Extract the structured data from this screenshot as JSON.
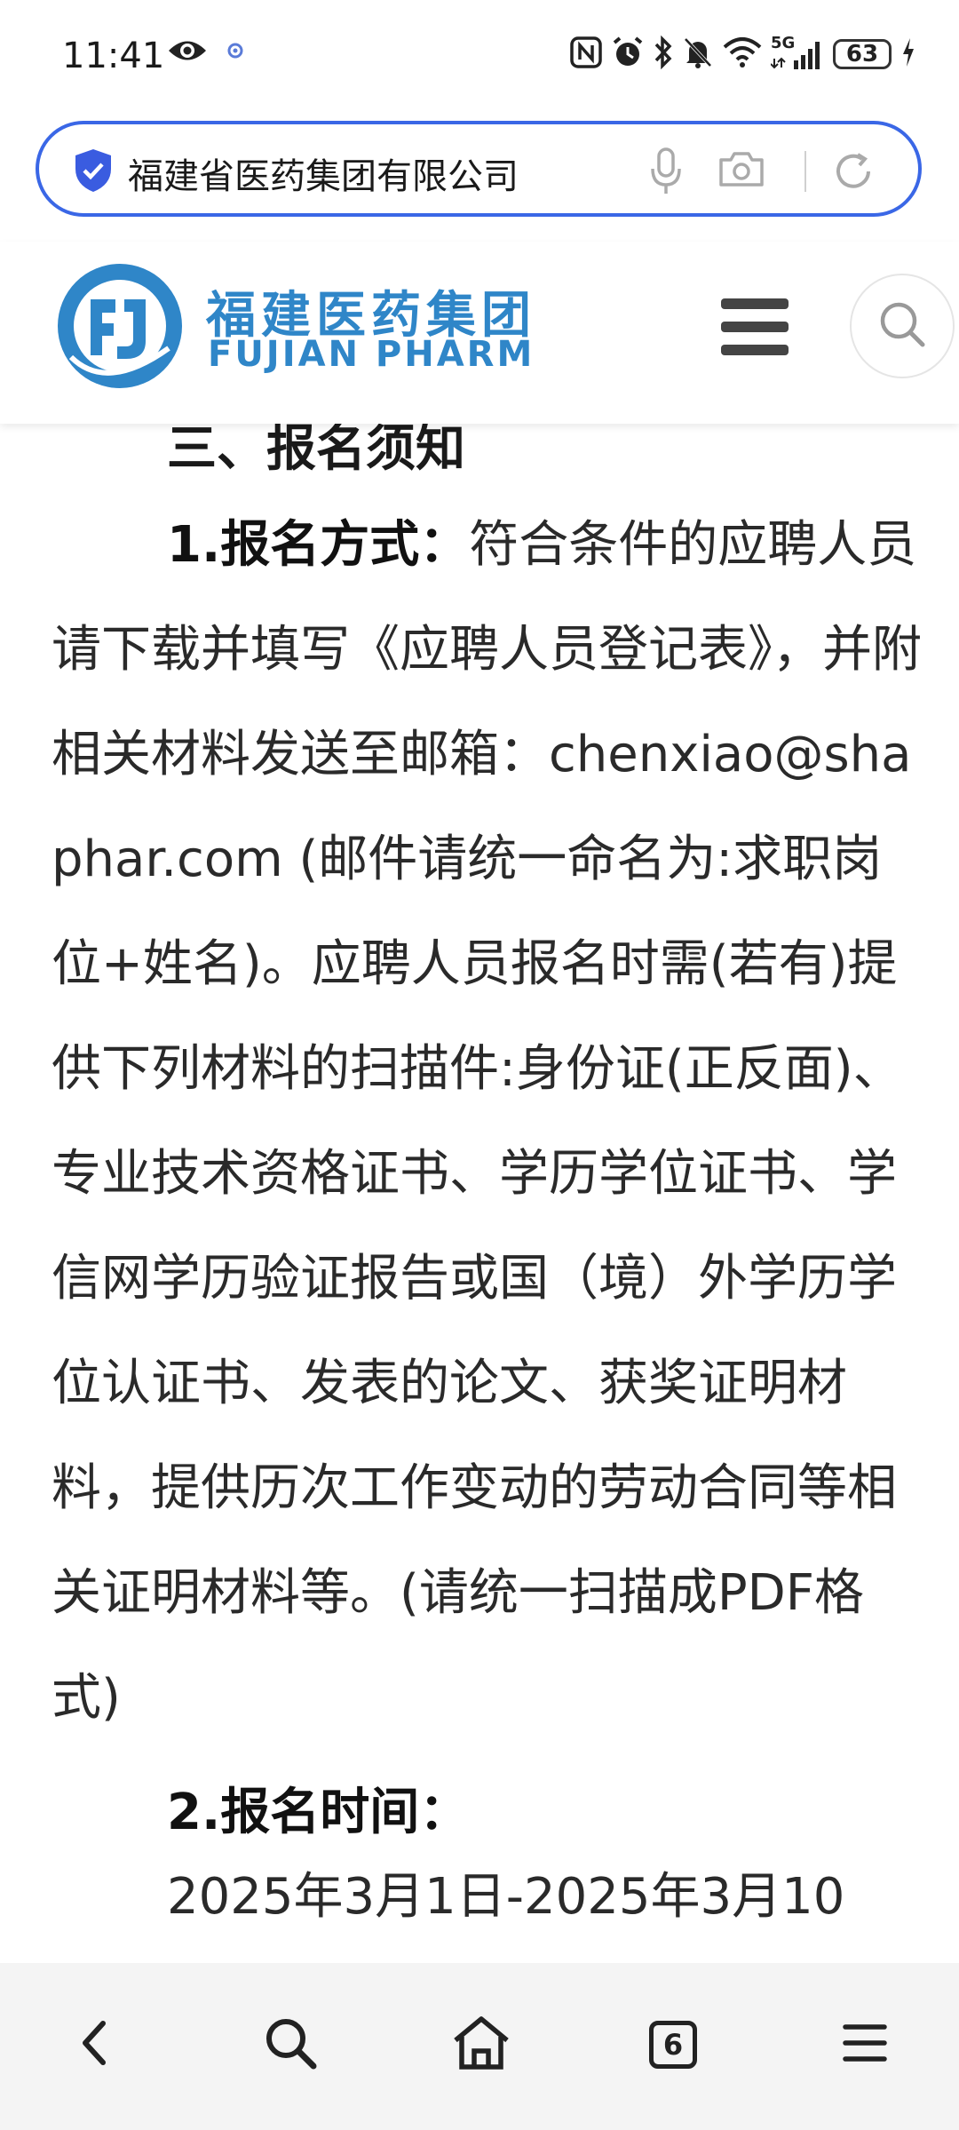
{
  "status_bar": {
    "time": "11:41",
    "network": "5G",
    "battery": "63",
    "icons": [
      "eye-icon",
      "location-dot-icon",
      "nfc-icon",
      "alarm-icon",
      "bluetooth-icon",
      "mute-icon",
      "wifi-icon",
      "signal-icon",
      "charging-icon"
    ]
  },
  "search": {
    "query": "福建省医药集团有限公司",
    "icons": [
      "shield-icon",
      "mic-icon",
      "camera-icon",
      "refresh-icon"
    ]
  },
  "site": {
    "logo_cn": "福建医药集团",
    "logo_en": "FUJIAN PHARM",
    "brand_color": "#2f86c8"
  },
  "article": {
    "section_heading": "三、报名须知",
    "item1_label": "1.报名方式：",
    "item1_text": "符合条件的应聘人员请下载并填写《应聘人员登记表》，并附相关材料发送至邮箱：chenxiao@shaphar.com (邮件请统一命名为:求职岗位+姓名)。应聘人员报名时需(若有)提供下列材料的扫描件:身份证(正反面)、专业技术资格证书、学历学位证书、学信网学历验证报告或国（境）外学历学位认证书、发表的论文、获奖证明材料，提供历次工作变动的劳动合同等相关证明材料等。(请统一扫描成PDF格式)",
    "item2_label": "2.报名时间：",
    "item2_text_partial": "2025年3月1日-2025年3月10"
  },
  "bottom_nav": {
    "tab_count": "6",
    "icons": [
      "back-icon",
      "search-icon",
      "home-icon",
      "tabs-icon",
      "menu-icon"
    ]
  },
  "colors": {
    "search_border": "#3a67e6",
    "shield": "#3a5ce0"
  }
}
